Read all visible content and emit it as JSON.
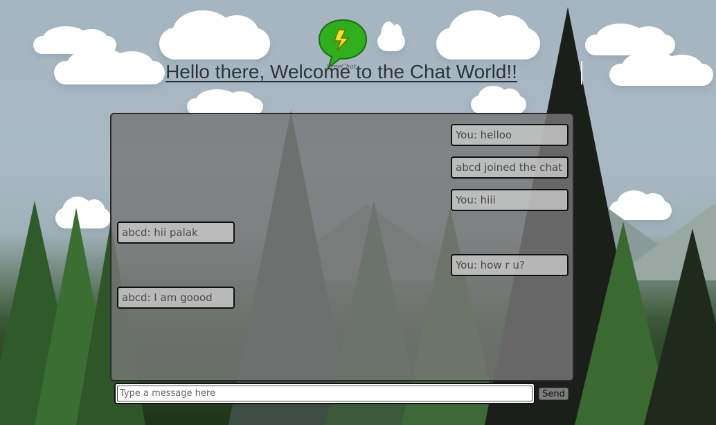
{
  "header": {
    "logo_text": "FreeChat",
    "title": "Hello there, Welcome to the Chat World!!"
  },
  "messages": [
    {
      "side": "right",
      "text": "You: helloo"
    },
    {
      "side": "right",
      "text": "abcd joined the chat"
    },
    {
      "side": "right",
      "text": "You: hiii"
    },
    {
      "side": "left",
      "text": "abcd: hii palak"
    },
    {
      "side": "right",
      "text": "You: how r u?"
    },
    {
      "side": "left",
      "text": "abcd: I am goood"
    }
  ],
  "composer": {
    "placeholder": "Type a message here",
    "value": "",
    "send_label": "Send"
  },
  "colors": {
    "logo_bubble": "#2fae1e",
    "logo_bolt": "#f2e51a",
    "panel_bg": "#787878"
  }
}
